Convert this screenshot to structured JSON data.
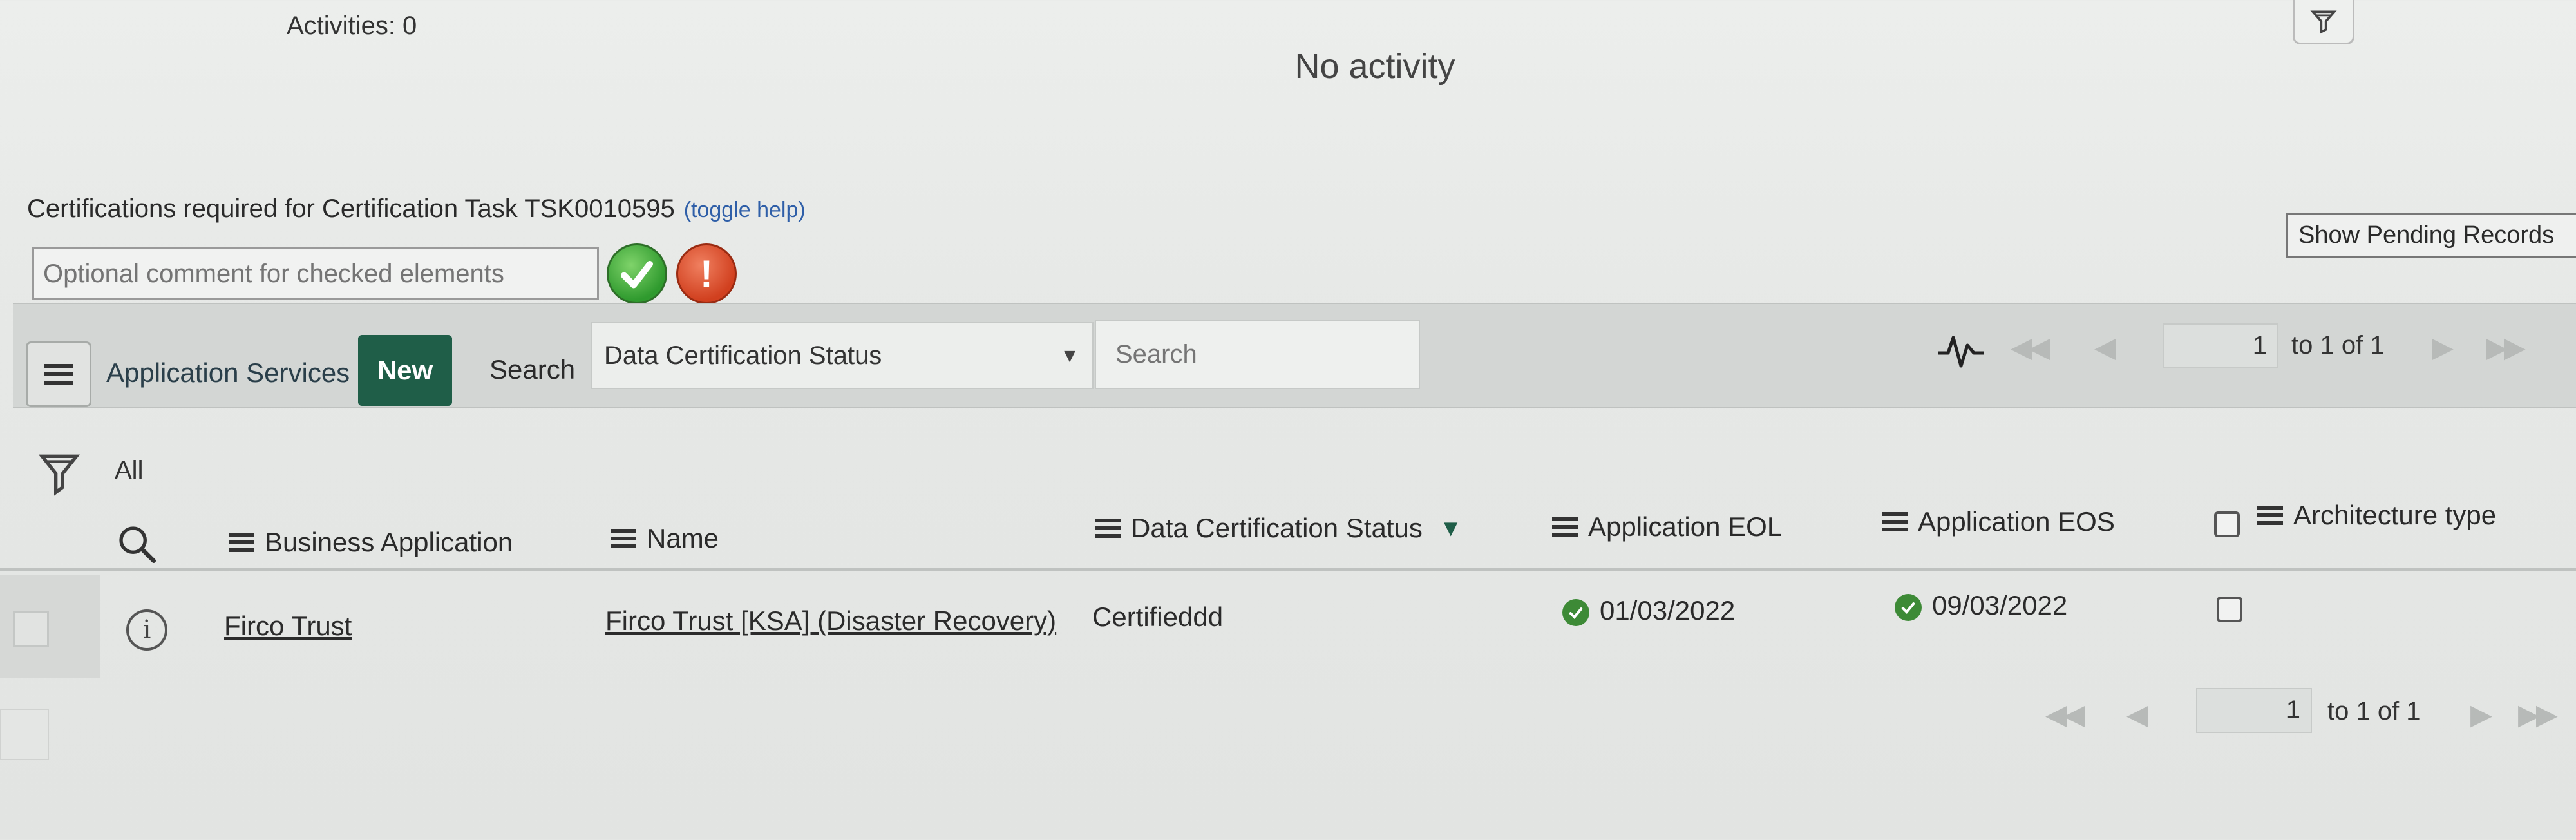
{
  "activities": {
    "count_label": "Activities: 0",
    "empty_message": "No activity"
  },
  "certification": {
    "title": "Certifications required for Certification Task TSK0010595",
    "toggle_help": "(toggle help)",
    "comment_placeholder": "Optional comment for checked elements",
    "reject_glyph": "!",
    "show_pending_label": "Show Pending Records"
  },
  "list": {
    "title": "Application Services",
    "new_label": "New",
    "search_label": "Search",
    "search_field_selected": "Data Certification Status",
    "search_placeholder": "Search",
    "filter_all_label": "All",
    "pagination": {
      "current_page": "1",
      "range_label": "to 1 of 1"
    },
    "columns": [
      {
        "label": "Business Application"
      },
      {
        "label": "Name"
      },
      {
        "label": "Data Certification Status",
        "sort": "descending"
      },
      {
        "label": "Application EOL"
      },
      {
        "label": "Application EOS"
      },
      {
        "label": "Architecture type"
      }
    ],
    "rows": [
      {
        "business_application": "Firco Trust",
        "name": "Firco Trust [KSA] (Disaster Recovery)",
        "data_certification_status": "Certifieddd",
        "application_eol": "01/03/2022",
        "application_eos": "09/03/2022",
        "architecture_type_checked": false
      }
    ],
    "bottom_pagination": {
      "current_page": "1",
      "range_label": "to 1 of 1"
    }
  },
  "colors": {
    "new_button": "#1f5e48",
    "approve": "#2f9a2e",
    "reject": "#d1401f",
    "status_ok": "#3d8a36",
    "link": "#2f5fa8"
  },
  "icons": {
    "filter": "filter-icon",
    "approve": "checkmark-icon",
    "reject": "exclamation-icon",
    "menu": "hamburger-icon",
    "activity": "activity-stream-icon",
    "search": "search-icon",
    "info": "info-icon",
    "status_ok": "check-circle-icon"
  }
}
